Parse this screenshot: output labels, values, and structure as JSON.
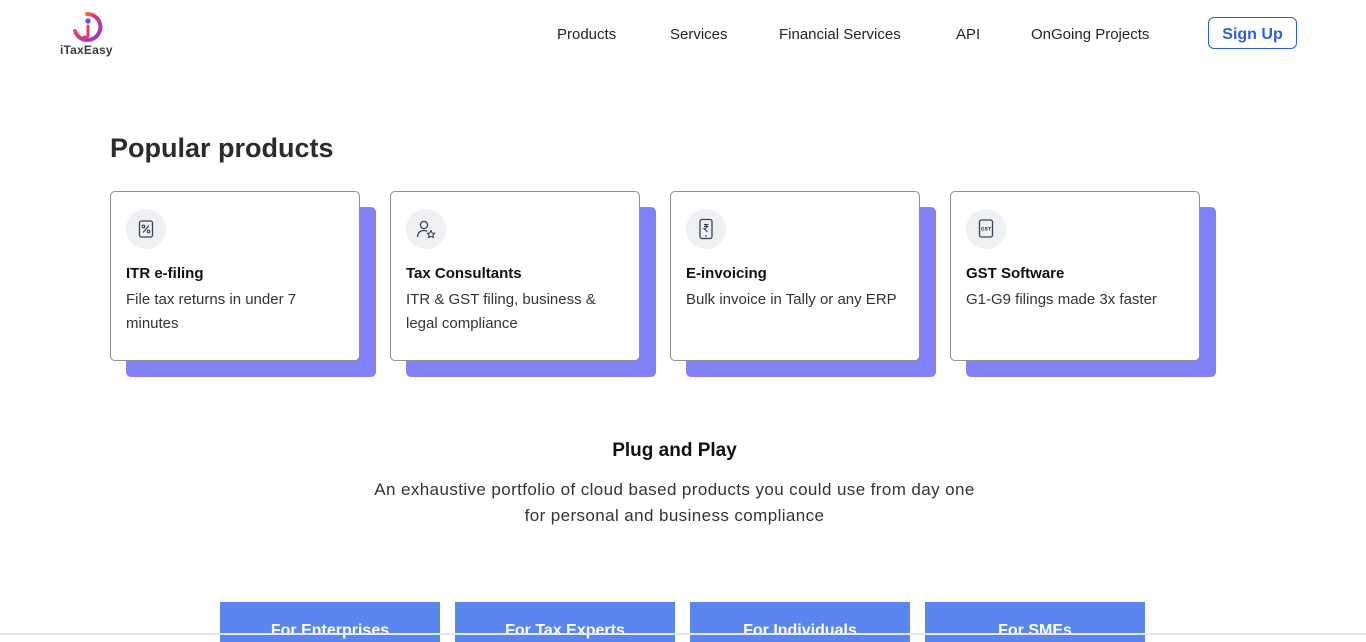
{
  "header": {
    "logo_text": "iTaxEasy",
    "nav": [
      "Products",
      "Services",
      "Financial Services",
      "API",
      "OnGoing Projects"
    ],
    "signup_label": "Sign Up"
  },
  "popular": {
    "title": "Popular products",
    "cards": [
      {
        "title": "ITR e-filing",
        "desc": "File tax returns in under 7 minutes",
        "icon": "percent-document-icon"
      },
      {
        "title": "Tax Consultants",
        "desc": "ITR & GST filing, business & legal compliance",
        "icon": "user-star-icon"
      },
      {
        "title": "E-invoicing",
        "desc": "Bulk invoice in Tally or any ERP",
        "icon": "rupee-phone-icon"
      },
      {
        "title": "GST Software",
        "desc": "G1-G9 filings made 3x faster",
        "icon": "gst-document-icon"
      }
    ]
  },
  "plug": {
    "title": "Plug and Play",
    "desc": "An exhaustive portfolio of cloud based products you could use from day one for personal and business compliance"
  },
  "tabs": [
    "For Enterprises",
    "For Tax Experts",
    "For Individuals",
    "For SMEs"
  ],
  "colors": {
    "accent": "#2d5de0",
    "card_shadow": "#8281f7",
    "tab_bg": "#5b86f0"
  }
}
